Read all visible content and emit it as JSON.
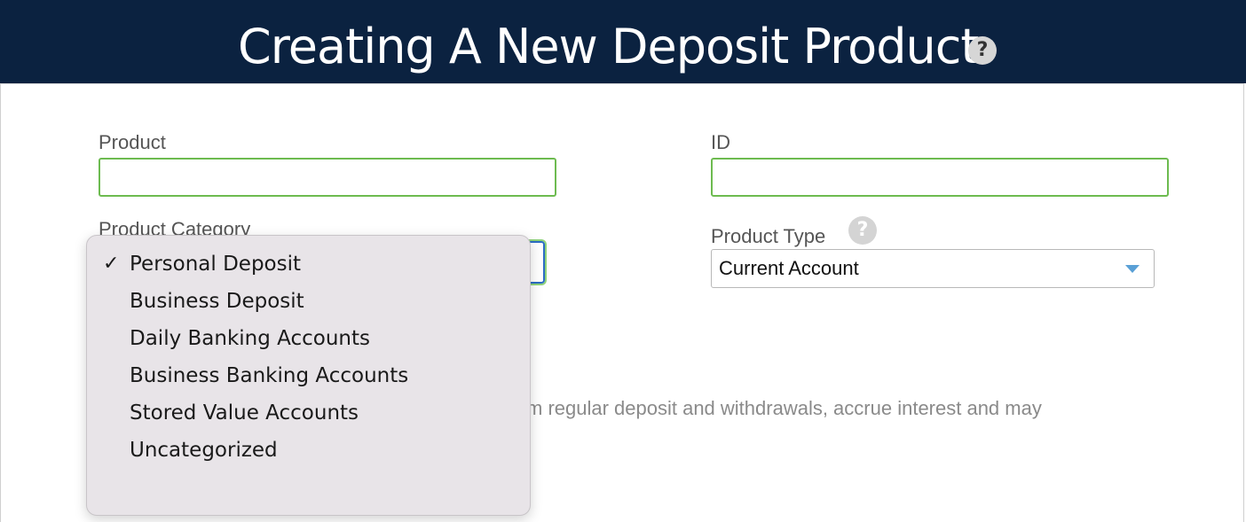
{
  "header": {
    "title": "Creating A New Deposit Product",
    "help_icon": "question-mark"
  },
  "form": {
    "product_label": "Product",
    "product_value": "",
    "id_label": "ID",
    "id_value": "",
    "category_label": "Product Category",
    "product_type_label": "Product Type",
    "product_type_value": "Current Account",
    "description_visible_fragment": "rform regular deposit and withdrawals, accrue interest and may"
  },
  "category_dropdown": {
    "selected": "Personal Deposit",
    "options": [
      "Personal Deposit",
      "Business Deposit",
      "Daily Banking Accounts",
      "Business Banking Accounts",
      "Stored Value Accounts",
      "Uncategorized"
    ],
    "check_glyph": "✓"
  },
  "colors": {
    "header_bg": "#0b2240",
    "valid_border": "#6dbb50",
    "focus_border": "#2b6cc4",
    "select_arrow": "#5aa0d6"
  }
}
